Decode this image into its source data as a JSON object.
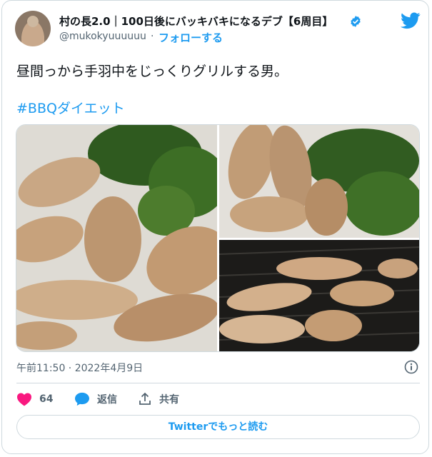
{
  "author": {
    "display_name": "村の長2.0｜100日後にバッキバキになるデブ【6周目】",
    "handle": "@mukokyuuuuuu",
    "separator": "·",
    "follow_label": "フォローする",
    "verified_icon": "verified-badge-icon",
    "avatar_icon": "avatar"
  },
  "tweet": {
    "text": "昼間っから手羽中をじっくりグリルする男。",
    "hashtag": "#BBQダイエット"
  },
  "meta": {
    "timestamp": "午前11:50 · 2022年4月9日",
    "info_icon": "info-icon"
  },
  "actions": {
    "like_count": "64",
    "reply_label": "返信",
    "share_label": "共有",
    "like_icon": "heart-icon",
    "reply_icon": "speech-bubble-icon",
    "share_icon": "share-icon"
  },
  "read_more_label": "Twitterでもっと読む",
  "colors": {
    "accent": "#1d9bf0",
    "like": "#f91880",
    "text": "#0f1419",
    "secondary": "#536471",
    "border": "#cfd9de"
  }
}
